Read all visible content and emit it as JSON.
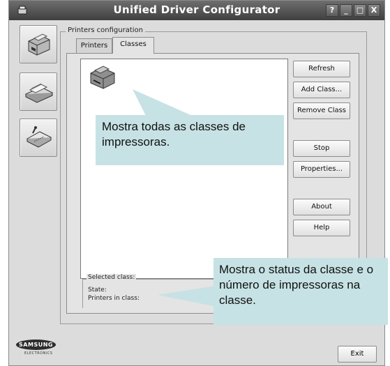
{
  "window": {
    "title": "Unified Driver Configurator",
    "controls": {
      "help": "?",
      "minimize": "_",
      "maximize": "□",
      "close": "X"
    }
  },
  "sidebar": {
    "items": [
      {
        "name": "printers",
        "icon": "printer-icon"
      },
      {
        "name": "scanners",
        "icon": "scanner-icon"
      },
      {
        "name": "ports",
        "icon": "port-icon"
      }
    ]
  },
  "group": {
    "label": "Printers configuration"
  },
  "tabs": [
    {
      "label": "Printers",
      "active": false
    },
    {
      "label": "Classes",
      "active": true
    }
  ],
  "buttons": {
    "refresh": "Refresh",
    "add_class": "Add Class...",
    "remove_class": "Remove Class",
    "stop": "Stop",
    "properties": "Properties...",
    "about": "About",
    "help": "Help",
    "exit": "Exit"
  },
  "selected_class": {
    "label": "Selected class:",
    "state_label": "State:",
    "printers_label": "Printers in class:"
  },
  "callouts": {
    "classes": "Mostra todas as classes de impressoras.",
    "status": "Mostra o status da classe e o número de impressoras na classe."
  },
  "logo": {
    "brand": "SAMSUNG",
    "sub": "ELECTRONICS"
  },
  "colors": {
    "callout_bg": "#c7e2e4",
    "titlebar": "#4a4a4a",
    "window_bg": "#dcdcdc"
  }
}
